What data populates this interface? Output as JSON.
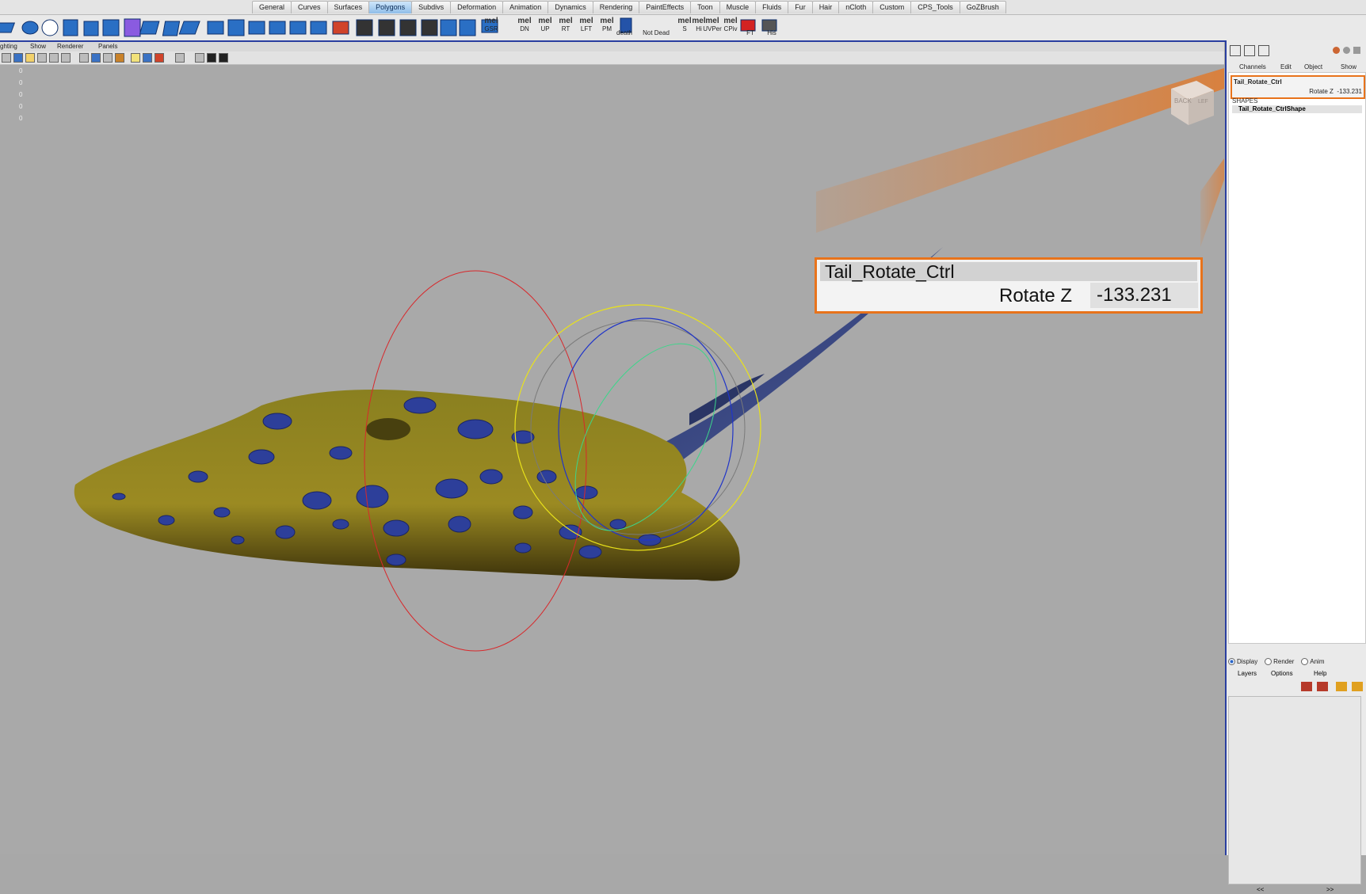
{
  "shelf_tabs": [
    "General",
    "Curves",
    "Surfaces",
    "Polygons",
    "Subdivs",
    "Deformation",
    "Animation",
    "Dynamics",
    "Rendering",
    "PaintEffects",
    "Toon",
    "Muscle",
    "Fluids",
    "Fur",
    "Hair",
    "nCloth",
    "Custom",
    "CPS_Tools",
    "GoZBrush"
  ],
  "active_tab": "Polygons",
  "shelf_labels": {
    "gsr": "GSR",
    "dn": "DN",
    "up": "UP",
    "rt": "RT",
    "lft": "LFT",
    "pm": "PM",
    "death": "death",
    "mel": "mel",
    "notdead": "Not Dead",
    "s": "S",
    "hi": "Hi",
    "uvper": "UVPer",
    "cpiv": "CPiv",
    "ft": "FT",
    "his": "His"
  },
  "panel_menu": {
    "lighting": "ghting",
    "show": "Show",
    "renderer": "Renderer",
    "panels": "Panels"
  },
  "hud_values": [
    "0",
    "0",
    "0",
    "0",
    "0"
  ],
  "viewcube_label": "BACK",
  "viewcube_side": "LEF",
  "channel_box": {
    "menu": {
      "channels": "Channels",
      "edit": "Edit",
      "object": "Object",
      "show": "Show"
    },
    "object_name": "Tail_Rotate_Ctrl",
    "attr_label": "Rotate Z",
    "attr_value": "-133.231",
    "shapes_label": "SHAPES",
    "shape_name": "Tail_Rotate_CtrlShape"
  },
  "callout": {
    "name": "Tail_Rotate_Ctrl",
    "label": "Rotate Z",
    "value": "-133.231"
  },
  "layer_editor": {
    "modes": [
      "Display",
      "Render",
      "Anim"
    ],
    "menu": {
      "layers": "Layers",
      "options": "Options",
      "help": "Help"
    },
    "prev": "<<",
    "next": ">>"
  },
  "colors": {
    "accent_orange": "#e8731b",
    "border_blue": "#2a3fa0",
    "active_tab": "#8fbde8"
  }
}
